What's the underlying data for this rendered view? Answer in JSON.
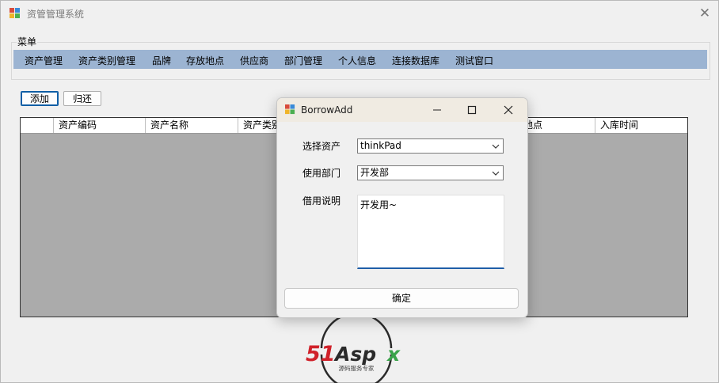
{
  "window": {
    "title": "资管管理系统"
  },
  "menu": {
    "legend": "菜单",
    "items": [
      "资产管理",
      "资产类别管理",
      "品牌",
      "存放地点",
      "供应商",
      "部门管理",
      "个人信息",
      "连接数据库",
      "测试窗口"
    ]
  },
  "toolbar": {
    "add_label": "添加",
    "return_label": "归还"
  },
  "grid": {
    "columns": [
      "",
      "资产编码",
      "资产名称",
      "资产类别",
      "地点",
      "入库时间"
    ]
  },
  "dialog": {
    "title": "BorrowAdd",
    "asset_label": "选择资产",
    "asset_value": "thinkPad",
    "dept_label": "使用部门",
    "dept_value": "开发部",
    "note_label": "借用说明",
    "note_value": "开发用~",
    "confirm_label": "确定"
  },
  "watermark": {
    "brand": "51Aspx",
    "tagline": "源码服务专家"
  },
  "colors": {
    "menubar": "#9cb4d2",
    "grid_body": "#ababab",
    "focus_accent": "#1f5ea8"
  }
}
